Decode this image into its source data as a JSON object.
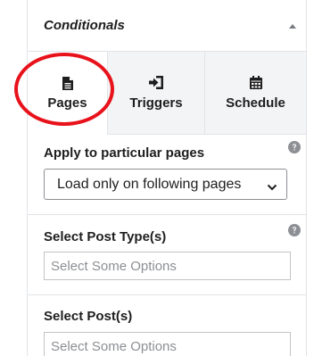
{
  "panel": {
    "title": "Conditionals",
    "collapse_icon": "triangle-up-icon"
  },
  "tabs": [
    {
      "label": "Pages",
      "icon": "file-icon",
      "active": true
    },
    {
      "label": "Triggers",
      "icon": "sign-in-icon",
      "active": false
    },
    {
      "label": "Schedule",
      "icon": "calendar-icon",
      "active": false
    }
  ],
  "apply_pages": {
    "label": "Apply to particular pages",
    "selected": "Load only on following pages",
    "help_icon": "question-circle-icon"
  },
  "post_types": {
    "label": "Select Post Type(s)",
    "placeholder": "Select Some Options",
    "help_icon": "question-circle-icon"
  },
  "posts": {
    "label": "Select Post(s)",
    "placeholder": "Select Some Options"
  },
  "colors": {
    "highlight": "#e8121b",
    "inactive_tab_bg": "#f3f4f5",
    "border": "#e2e4e7"
  }
}
